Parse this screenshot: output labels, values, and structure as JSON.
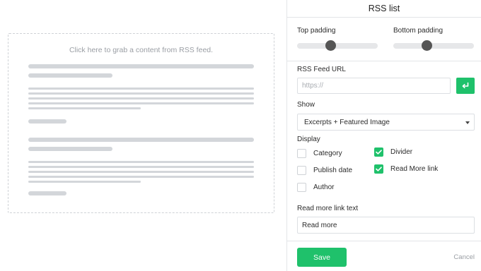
{
  "preview": {
    "hint": "Click here to grab a content from RSS feed."
  },
  "panel": {
    "title": "RSS list",
    "top_padding_label": "Top padding",
    "bottom_padding_label": "Bottom padding",
    "top_padding_value": 0.4,
    "bottom_padding_value": 0.4,
    "rss_url_label": "RSS Feed URL",
    "rss_url_placeholder": "https://",
    "rss_url_value": "",
    "show_label": "Show",
    "show_selected": "Excerpts + Featured Image",
    "display_label": "Display",
    "display_options": [
      {
        "label": "Category",
        "checked": false
      },
      {
        "label": "Publish date",
        "checked": false
      },
      {
        "label": "Author",
        "checked": false
      },
      {
        "label": "Divider",
        "checked": true
      },
      {
        "label": "Read More link",
        "checked": true
      }
    ],
    "read_more_label": "Read more link text",
    "read_more_value": "Read more",
    "save_label": "Save",
    "cancel_label": "Cancel"
  },
  "icons": {
    "enter": "enter-icon",
    "check": "checkmark-icon",
    "caret": "chevron-down-icon"
  },
  "colors": {
    "accent": "#1fc16b",
    "skeleton": "#d3d6da",
    "slider_knob": "#555555"
  }
}
